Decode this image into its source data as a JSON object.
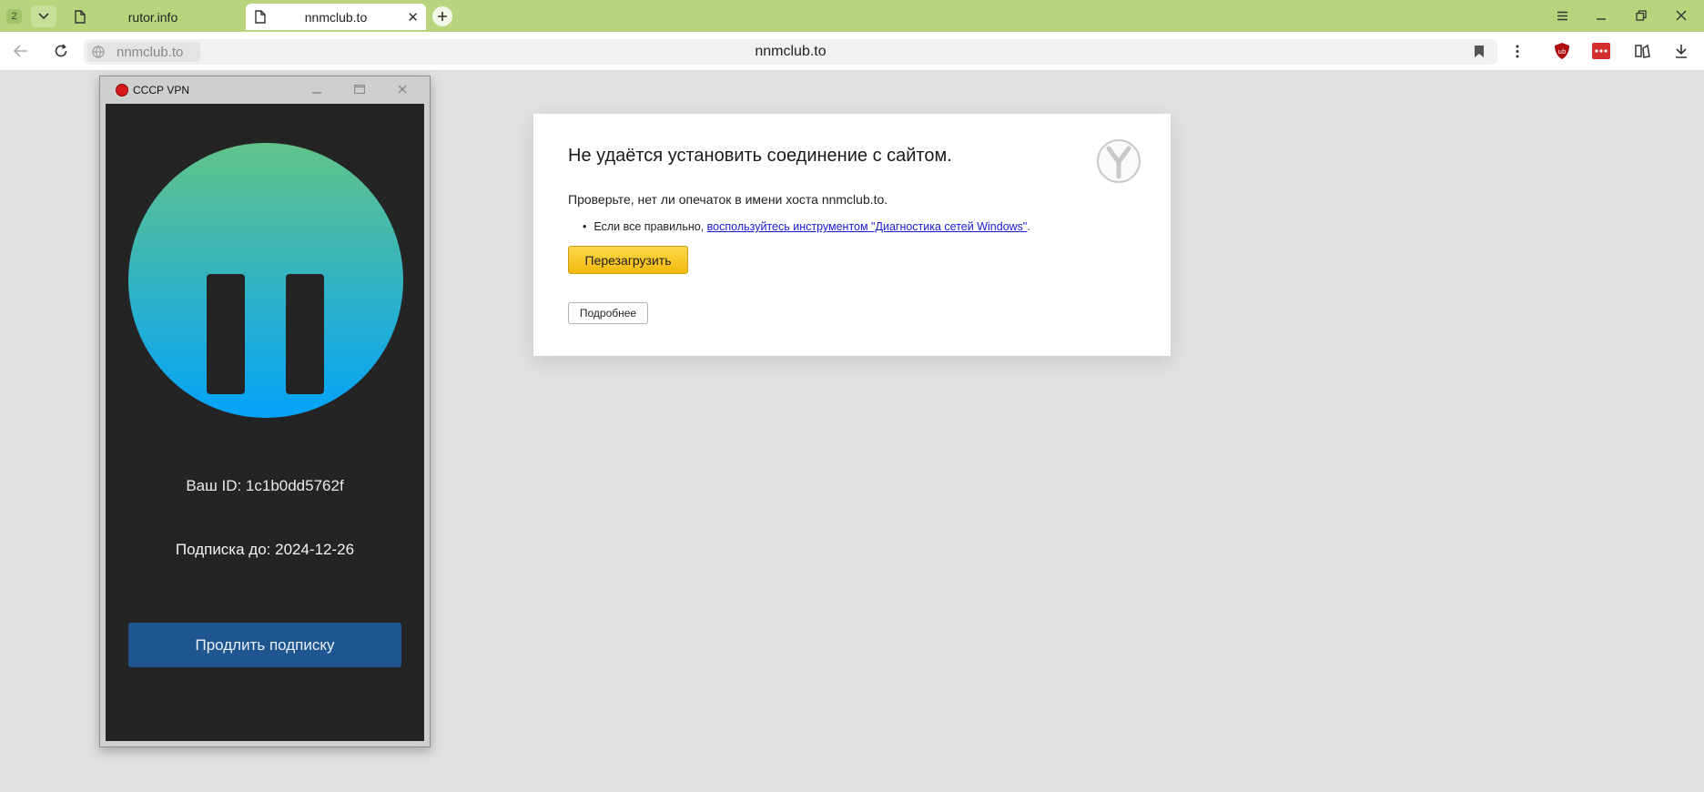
{
  "browser": {
    "tab_count": "2",
    "tabs": [
      {
        "title": "rutor.info"
      },
      {
        "title": "nnmclub.to"
      }
    ],
    "address_host_chip": "nnmclub.to",
    "address_url": "nnmclub.to",
    "theme_color": "#b8d57e"
  },
  "error_page": {
    "title": "Не удаётся установить соединение с сайтом.",
    "hint": "Проверьте, нет ли опечаток в имени хоста nnmclub.to.",
    "bullet_prefix": "Если все правильно, ",
    "bullet_link": "воспользуйтесь инструментом \"Диагностика сетей Windows\"",
    "bullet_suffix": ".",
    "reload_label": "Перезагрузить",
    "details_label": "Подробнее"
  },
  "vpn_app": {
    "window_title": "СССР VPN",
    "state": "paused",
    "id_line": "Ваш ID: 1c1b0dd5762f",
    "subscription_line": "Подписка до: 2024-12-26",
    "renew_label": "Продлить подписку",
    "accent_color": "#1f568f"
  }
}
